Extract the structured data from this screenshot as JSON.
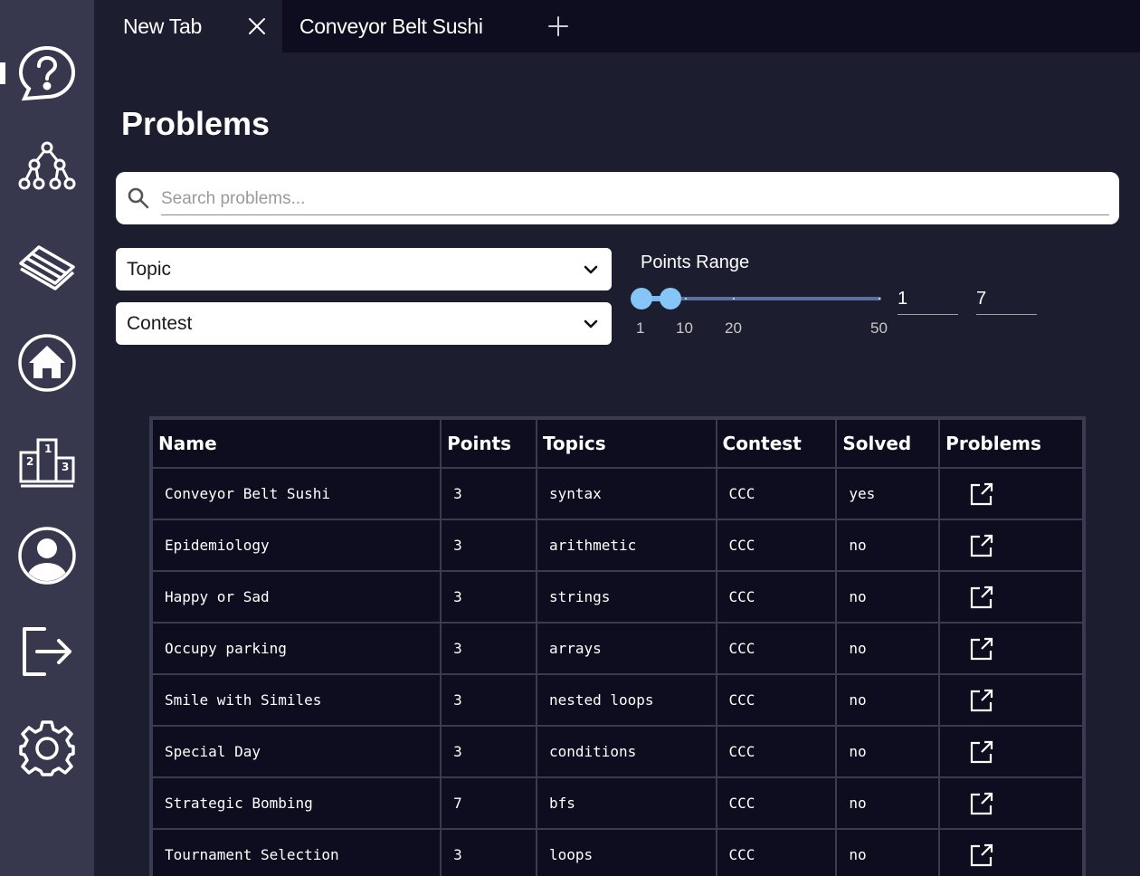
{
  "tabs": [
    {
      "label": "New Tab"
    },
    {
      "label": "Conveyor Belt Sushi"
    }
  ],
  "sidebar": {
    "items": [
      {
        "icon": "help-icon"
      },
      {
        "icon": "tree-icon"
      },
      {
        "icon": "layers-icon"
      },
      {
        "icon": "home-icon"
      },
      {
        "icon": "podium-icon"
      },
      {
        "icon": "profile-icon"
      },
      {
        "icon": "logout-icon"
      },
      {
        "icon": "gear-icon"
      }
    ]
  },
  "page": {
    "title": "Problems"
  },
  "search": {
    "placeholder": "Search problems..."
  },
  "filters": {
    "topic_label": "Topic",
    "contest_label": "Contest"
  },
  "points_range": {
    "label": "Points Range",
    "min_value": "1",
    "max_value": "7",
    "ticks": [
      "1",
      "10",
      "20",
      "50"
    ]
  },
  "table": {
    "headers": [
      "Name",
      "Points",
      "Topics",
      "Contest",
      "Solved",
      "Problems"
    ],
    "rows": [
      {
        "name": "Conveyor Belt Sushi",
        "points": "3",
        "topics": "syntax",
        "contest": "CCC",
        "solved": "yes"
      },
      {
        "name": "Epidemiology",
        "points": "3",
        "topics": "arithmetic",
        "contest": "CCC",
        "solved": "no"
      },
      {
        "name": "Happy or Sad",
        "points": "3",
        "topics": "strings",
        "contest": "CCC",
        "solved": "no"
      },
      {
        "name": "Occupy parking",
        "points": "3",
        "topics": "arrays",
        "contest": "CCC",
        "solved": "no"
      },
      {
        "name": "Smile with Similes",
        "points": "3",
        "topics": "nested loops",
        "contest": "CCC",
        "solved": "no"
      },
      {
        "name": "Special Day",
        "points": "3",
        "topics": "conditions",
        "contest": "CCC",
        "solved": "no"
      },
      {
        "name": "Strategic Bombing",
        "points": "7",
        "topics": "bfs",
        "contest": "CCC",
        "solved": "no"
      },
      {
        "name": "Tournament Selection",
        "points": "3",
        "topics": "loops",
        "contest": "CCC",
        "solved": "no"
      }
    ]
  },
  "colors": {
    "background": "#1d1d30",
    "sidebar": "#37374d",
    "tabbar": "#0d0d1f",
    "table_bg": "#0d0d1f",
    "slider_accent": "#86c5f7"
  }
}
